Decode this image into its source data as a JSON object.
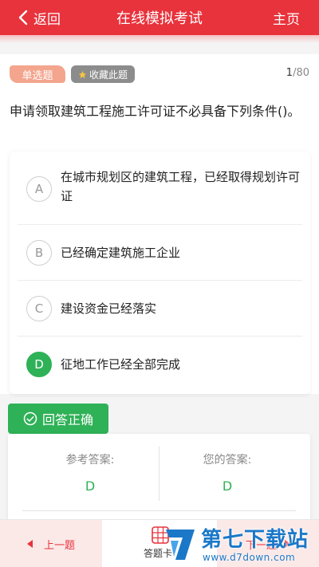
{
  "header": {
    "back_label": "返回",
    "title": "在线模拟考试",
    "home_label": "主页"
  },
  "question": {
    "type_tag": "单选题",
    "favorite_label": "收藏此题",
    "progress_current": "1",
    "progress_total": "/80",
    "text": "申请领取建筑工程施工许可证不必具备下列条件()。",
    "options": [
      {
        "letter": "A",
        "text": "在城市规划区的建筑工程，已经取得规划许可证"
      },
      {
        "letter": "B",
        "text": "已经确定建筑施工企业"
      },
      {
        "letter": "C",
        "text": "建设资金已经落实"
      },
      {
        "letter": "D",
        "text": "征地工作已经全部完成"
      }
    ],
    "selected": "D"
  },
  "result": {
    "status_label": "回答正确",
    "reference_label": "参考答案:",
    "reference_value": "D",
    "yours_label": "您的答案:",
    "yours_value": "D"
  },
  "bottom": {
    "prev_label": "上一题",
    "card_label": "答题卡",
    "next_label": "下一题"
  },
  "watermark": {
    "title": "第七下载站",
    "url": "www.d7down.com"
  },
  "colors": {
    "brand_red": "#e8323c",
    "correct_green": "#2fb157",
    "watermark_blue": "#1b78c8"
  }
}
